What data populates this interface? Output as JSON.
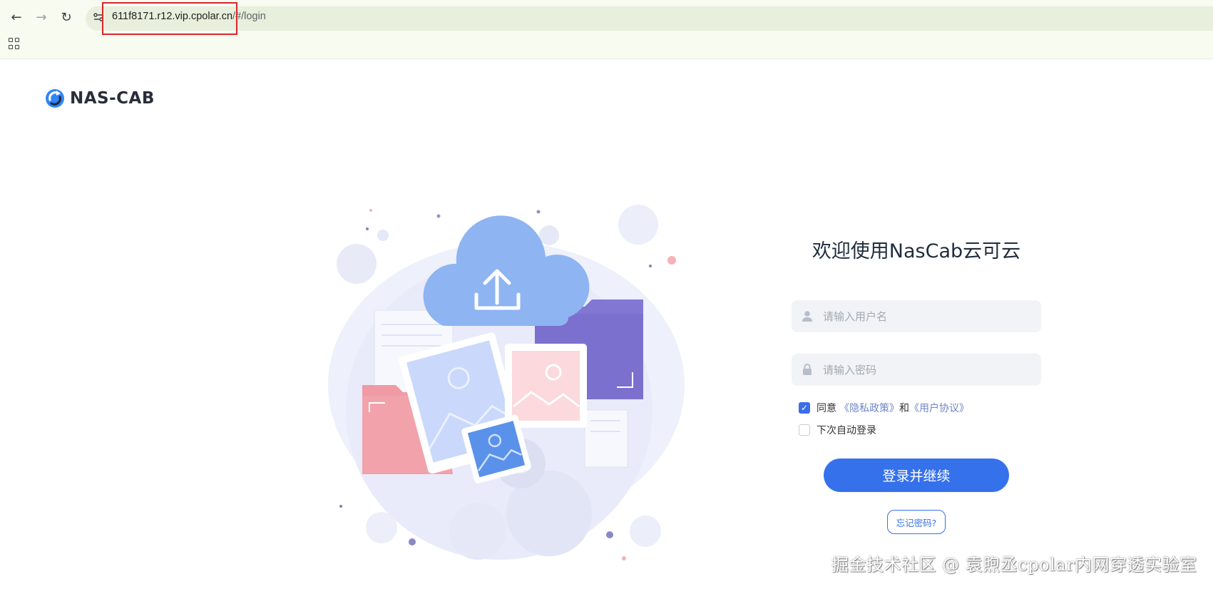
{
  "browser": {
    "url_host": "611f8171.r12.vip.cpolar.cn",
    "url_path": "/#/login"
  },
  "logo": {
    "text": "NAS-CAB"
  },
  "login": {
    "title": "欢迎使用NasCab云可云",
    "username_placeholder": "请输入用户名",
    "password_placeholder": "请输入密码",
    "agree_prefix": "同意",
    "privacy_link": "《隐私政策》",
    "agree_and": "和",
    "terms_link": "《用户协议》",
    "agree_checked": true,
    "auto_login_label": "下次自动登录",
    "auto_login_checked": false,
    "submit_label": "登录并继续",
    "forgot_label": "忘记密码?"
  },
  "watermark": "掘金技术社区 @ 袁煦丞cpolar内网穿透实验室",
  "colors": {
    "primary": "#3671ec",
    "highlight_box": "#d9262c"
  }
}
